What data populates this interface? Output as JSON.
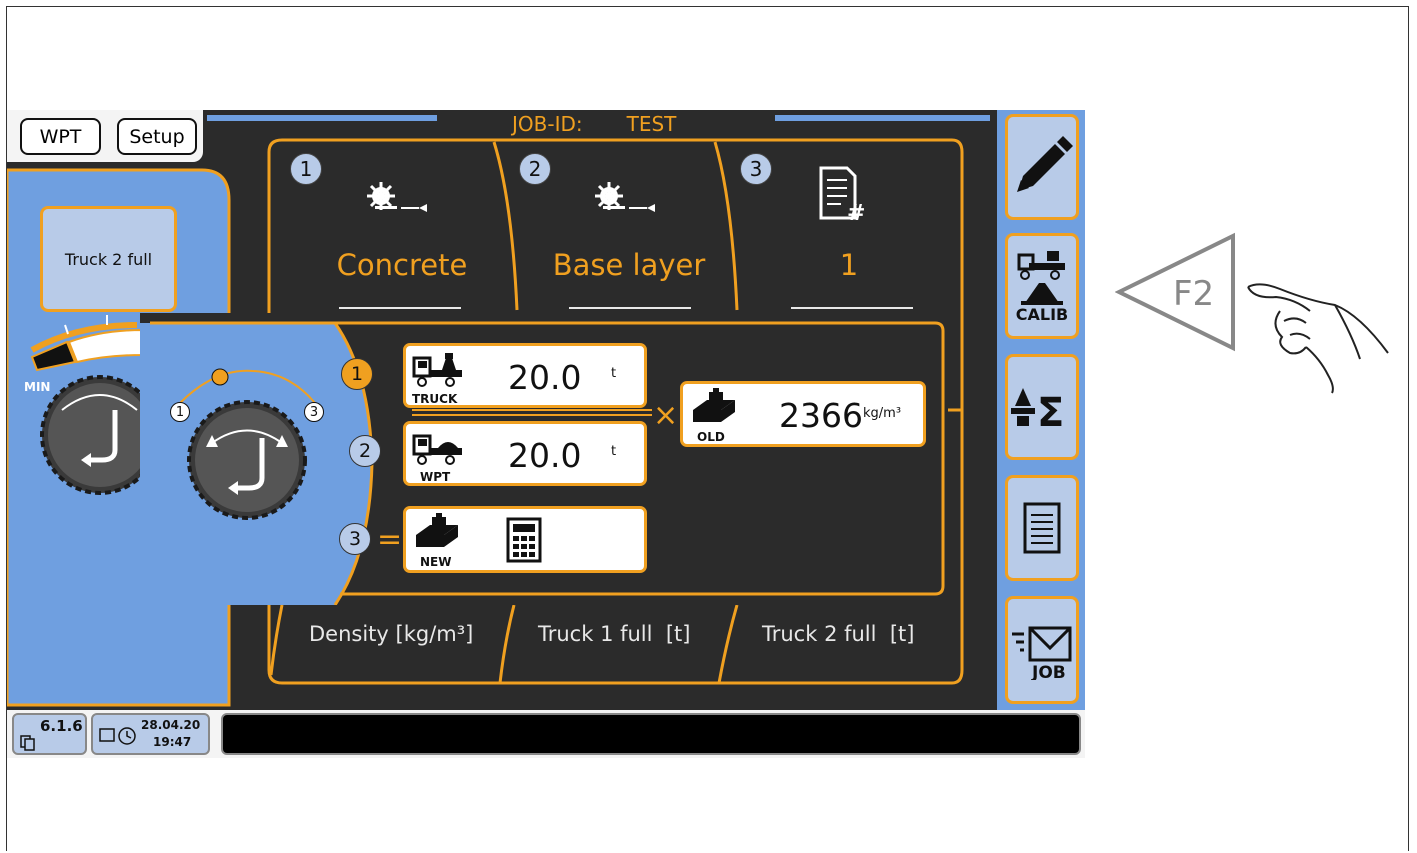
{
  "header": {
    "wpt_label": "WPT",
    "setup_label": "Setup",
    "job_id_label": "JOB-ID:",
    "job_id_value": "TEST"
  },
  "left": {
    "truck_button": "Truck 2 full",
    "min_label": "MIN"
  },
  "columns": [
    {
      "num": "1",
      "value": "Concrete",
      "footer": "Density [kg/m³]"
    },
    {
      "num": "2",
      "value": "Base layer",
      "footer": "Truck 1 full  [t]"
    },
    {
      "num": "3",
      "value": "1",
      "footer": "Truck 2 full  [t]"
    }
  ],
  "panel": {
    "knob_positions": [
      "1",
      "2",
      "3"
    ],
    "steps": [
      "1",
      "2",
      "3"
    ],
    "truck_value": "20.0",
    "truck_unit": "t",
    "truck_caption": "TRUCK",
    "wpt_value": "20.0",
    "wpt_unit": "t",
    "wpt_caption": "WPT",
    "old_density_value": "2366",
    "old_density_unit": "kg/m³",
    "old_caption": "OLD",
    "new_caption": "NEW",
    "multiply_sign": "×",
    "equals_sign": "="
  },
  "sidebar": {
    "items": [
      {
        "icon": "pencil-icon"
      },
      {
        "icon": "calib-icon",
        "label": "CALIB"
      },
      {
        "icon": "sum-icon"
      },
      {
        "icon": "list-icon"
      },
      {
        "icon": "job-mail-icon",
        "label": "JOB"
      }
    ]
  },
  "status": {
    "version": "6.1.6",
    "date": "28.04.20",
    "time": "19:47"
  },
  "callout": {
    "key_label": "F2"
  },
  "colors": {
    "accent": "#f0a020",
    "panel_blue": "#6f9fe0",
    "button_blue": "#b8cbe8",
    "screen_bg": "#2b2b2b"
  }
}
